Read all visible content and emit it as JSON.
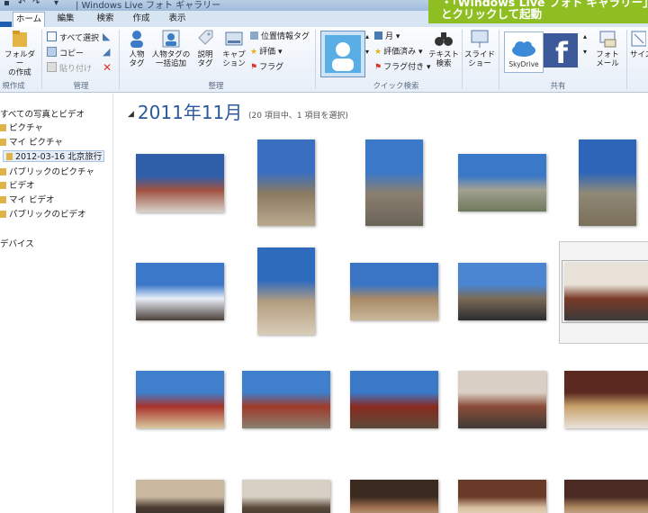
{
  "titlebar": {
    "title": "| Windows Live フォト ギャラリー"
  },
  "callout": {
    "line1": "・「Windows Live フォト ギャラリー」",
    "line2": "とクリックして起動"
  },
  "tabs": [
    {
      "label": "ホーム",
      "active": true
    },
    {
      "label": "編集"
    },
    {
      "label": "検索"
    },
    {
      "label": "作成"
    },
    {
      "label": "表示"
    }
  ],
  "ribbon": {
    "new_folder": "フォルダー\nの作成",
    "select_all": "すべて選択",
    "copy": "コピー",
    "paste": "貼り付け",
    "people_tag": "人物\nタグ",
    "batch_people": "人物タグの\n一括追加",
    "desc_tag": "説明\nタグ",
    "caption": "キャプ\nション",
    "geotag": "位置情報タグ",
    "rating": "評価",
    "flag": "フラグ",
    "month": "月",
    "rated": "評価済み",
    "flagged": "フラグ付き",
    "text_search": "テキスト\n検索",
    "slideshow": "スライド\nショー",
    "skydrive": "SkyDrive",
    "photo_mail": "フォト\nメール",
    "size": "サイズ",
    "groups": {
      "new": "規作成",
      "manage": "管理",
      "organize": "整理",
      "quick_search": "クイック検索",
      "share": "共有"
    }
  },
  "nav": {
    "items": [
      {
        "label": "すべての写真とビデオ"
      },
      {
        "label": "ピクチャ"
      },
      {
        "label": "マイ ピクチャ"
      },
      {
        "label": "2012-03-16 北京旅行",
        "selected": true
      },
      {
        "label": "パブリックのピクチャ"
      },
      {
        "label": "ビデオ"
      },
      {
        "label": "マイ ビデオ"
      },
      {
        "label": "パブリックのビデオ"
      },
      {
        "label": "デバイス"
      }
    ]
  },
  "content": {
    "heading": "2011年11月",
    "count": "(20 項目中、1 項目を選択)",
    "photos": [
      {
        "name": "gate",
        "colors": [
          "#2f5fa8",
          "#a05040",
          "#d8d4cc"
        ]
      },
      {
        "name": "courtyard-tree",
        "colors": [
          "#3a6fc0",
          "#8a7a62",
          "#b8a98e"
        ]
      },
      {
        "name": "wall-arch",
        "colors": [
          "#3b78c8",
          "#8b8070",
          "#6b6358"
        ]
      },
      {
        "name": "great-wall-1",
        "colors": [
          "#3a78c8",
          "#a2a092",
          "#6e7a5a"
        ]
      },
      {
        "name": "great-wall-2",
        "colors": [
          "#2d66b8",
          "#8f8977",
          "#7a6f5a"
        ]
      },
      {
        "name": "mountain-sun",
        "colors": [
          "#3b78c9",
          "#e8eef8",
          "#4a4038"
        ]
      },
      {
        "name": "ruin-arch",
        "colors": [
          "#2f6bbd",
          "#b39d80",
          "#d8cdb8"
        ]
      },
      {
        "name": "ruin-arch-2",
        "colors": [
          "#3a75c5",
          "#a88a66",
          "#c9b89a"
        ]
      },
      {
        "name": "tower-tilted",
        "colors": [
          "#4a86d2",
          "#7a6a56",
          "#2c2c30"
        ]
      },
      {
        "name": "food-plate",
        "colors": [
          "#e8e2d8",
          "#7a3a28",
          "#3a3a3a"
        ],
        "selected": true
      },
      {
        "name": "tiananmen",
        "colors": [
          "#3f7fcc",
          "#a8322a",
          "#d9c9a0"
        ]
      },
      {
        "name": "palace-hall",
        "colors": [
          "#3f7fcc",
          "#a03a2a",
          "#8a8070"
        ]
      },
      {
        "name": "lion-statue",
        "colors": [
          "#3a78c8",
          "#8a2a20",
          "#5a4a3a"
        ]
      },
      {
        "name": "dish-table",
        "colors": [
          "#d9cfc4",
          "#8a4c38",
          "#3f3a36"
        ]
      },
      {
        "name": "restaurant",
        "colors": [
          "#5a2a20",
          "#c9a26a",
          "#e8e2da"
        ]
      },
      {
        "name": "row4-1",
        "colors": [
          "#c8b8a0",
          "#4a3a30",
          "#2a2a2a"
        ]
      },
      {
        "name": "row4-2",
        "colors": [
          "#d8d0c4",
          "#5a4a3a",
          "#2e2a26"
        ]
      },
      {
        "name": "row4-3",
        "colors": [
          "#3a2a20",
          "#a07050",
          "#e0d0b8"
        ]
      },
      {
        "name": "row4-4",
        "colors": [
          "#6a3a28",
          "#d8c0a0",
          "#f0e8dc"
        ]
      },
      {
        "name": "row4-5",
        "colors": [
          "#4a2a22",
          "#b08a60",
          "#e0d8d0"
        ]
      }
    ]
  }
}
